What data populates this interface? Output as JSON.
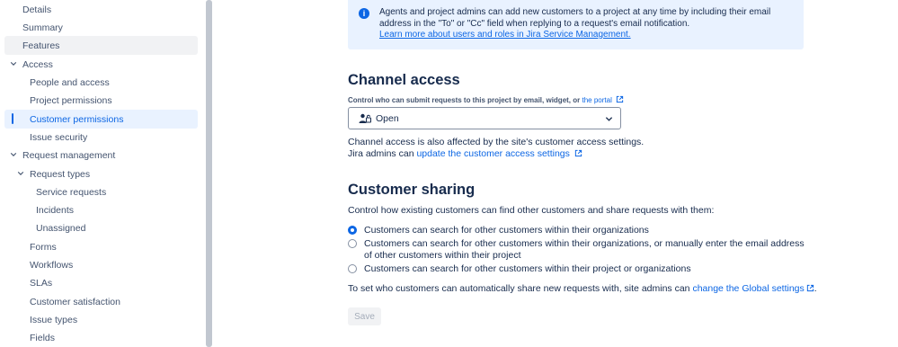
{
  "sidebar": {
    "items": [
      {
        "label": "Details"
      },
      {
        "label": "Summary"
      },
      {
        "label": "Features"
      },
      {
        "label": "Access"
      },
      {
        "label": "People and access"
      },
      {
        "label": "Project permissions"
      },
      {
        "label": "Customer permissions"
      },
      {
        "label": "Issue security"
      },
      {
        "label": "Request management"
      },
      {
        "label": "Request types"
      },
      {
        "label": "Service requests"
      },
      {
        "label": "Incidents"
      },
      {
        "label": "Unassigned"
      },
      {
        "label": "Forms"
      },
      {
        "label": "Workflows"
      },
      {
        "label": "SLAs"
      },
      {
        "label": "Customer satisfaction"
      },
      {
        "label": "Issue types"
      },
      {
        "label": "Fields"
      }
    ]
  },
  "info": {
    "text": "Agents and project admins can add new customers to a project at any time by including their email address in the \"To\" or \"Cc\" field when replying to a request's email notification.",
    "link": "Learn more about users and roles in Jira Service Management."
  },
  "channel": {
    "title": "Channel access",
    "helper": "Control who can submit requests to this project by email, widget, or",
    "helper_link": "the portal",
    "selected": "Open",
    "note_line1": "Channel access is also affected by the site's customer access settings.",
    "note_line2": "Jira admins can",
    "note_link": "update the customer access settings"
  },
  "sharing": {
    "title": "Customer sharing",
    "intro": "Control how existing customers can find other customers and share requests with them:",
    "options": [
      {
        "label": "Customers can search for other customers within their organizations",
        "checked": true
      },
      {
        "label": "Customers can search for other customers within their organizations, or manually enter the email address of other customers within their project",
        "checked": false
      },
      {
        "label": "Customers can search for other customers within their project or organizations",
        "checked": false
      }
    ],
    "footer": "To set who customers can automatically share new requests with, site admins can",
    "footer_link": "change the Global settings",
    "footer_end": "."
  },
  "save_label": "Save",
  "colors": {
    "accent": "#0c66e4",
    "selected_bg": "#e9f2ff",
    "info_bg": "#e9f2ff"
  }
}
